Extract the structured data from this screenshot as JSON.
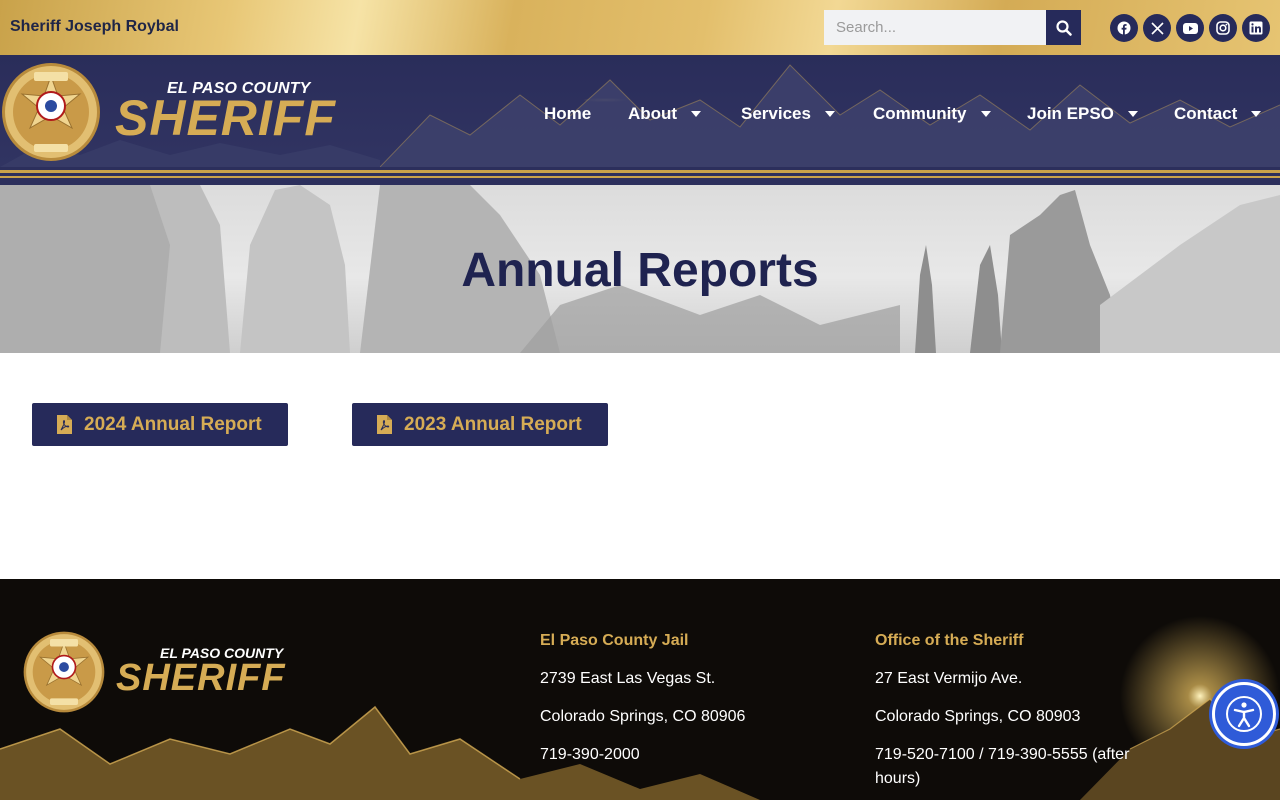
{
  "topbar": {
    "sheriff_name": "Sheriff Joseph Roybal",
    "search_placeholder": "Search...",
    "socials": [
      "facebook-icon",
      "x-icon",
      "youtube-icon",
      "instagram-icon",
      "linkedin-icon"
    ]
  },
  "header": {
    "brand_small": "EL PASO COUNTY",
    "brand_big": "SHERIFF",
    "nav": [
      {
        "label": "Home",
        "has_dropdown": false
      },
      {
        "label": "About",
        "has_dropdown": true
      },
      {
        "label": "Services",
        "has_dropdown": true
      },
      {
        "label": "Community",
        "has_dropdown": true
      },
      {
        "label": "Join EPSO",
        "has_dropdown": true
      },
      {
        "label": "Contact",
        "has_dropdown": true
      }
    ]
  },
  "hero": {
    "title": "Annual Reports"
  },
  "reports": [
    {
      "label": "2024 Annual Report",
      "icon": "file-pdf-icon"
    },
    {
      "label": "2023 Annual Report",
      "icon": "file-pdf-icon"
    }
  ],
  "footer": {
    "brand_small": "EL PASO COUNTY",
    "brand_big": "SHERIFF",
    "jail": {
      "heading": "El Paso County Jail",
      "address1": "2739 East Las Vegas St.",
      "address2": "Colorado Springs, CO 80906",
      "phone": "719-390-2000"
    },
    "office": {
      "heading": "Office of the Sheriff",
      "address1": "27 East Vermijo Ave.",
      "address2": "Colorado Springs, CO 80903",
      "phone": "719-520-7100 / 719-390-5555 (after hours)"
    }
  },
  "colors": {
    "navy": "#262a5a",
    "gold": "#d6ac55",
    "accessibility_blue": "#2f5bd8"
  }
}
